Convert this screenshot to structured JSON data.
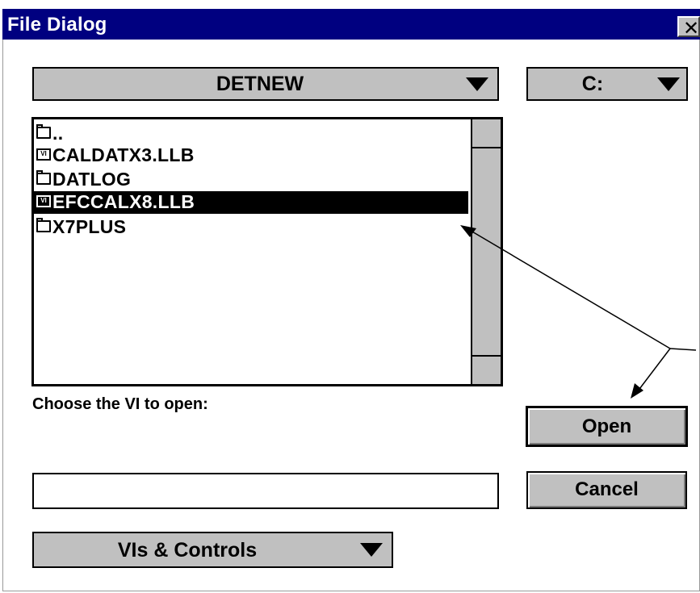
{
  "window": {
    "title": "File Dialog",
    "close_glyph": "✕"
  },
  "folder_dropdown": {
    "value": "DETNEW"
  },
  "drive_dropdown": {
    "value": "C:"
  },
  "file_list": {
    "items": [
      {
        "name": "..",
        "type": "parent-folder",
        "icon": "open-folder-icon",
        "selected": false
      },
      {
        "name": "CALDATX3.LLB",
        "type": "vi-library",
        "icon": "vi-library-icon",
        "selected": false
      },
      {
        "name": "DATLOG",
        "type": "folder",
        "icon": "folder-icon",
        "selected": false
      },
      {
        "name": "EFCCALX8.LLB",
        "type": "vi-library",
        "icon": "vi-library-icon",
        "selected": true
      },
      {
        "name": "X7PLUS",
        "type": "folder",
        "icon": "folder-icon",
        "selected": false
      }
    ],
    "vi_icon_text": "VI"
  },
  "prompt_label": "Choose the VI to open:",
  "filename_input": {
    "value": ""
  },
  "buttons": {
    "open": "Open",
    "cancel": "Cancel"
  },
  "filter_dropdown": {
    "value": "VIs & Controls"
  },
  "colors": {
    "titlebar": "#000080",
    "control": "#c0c0c0",
    "selection": "#000000"
  }
}
